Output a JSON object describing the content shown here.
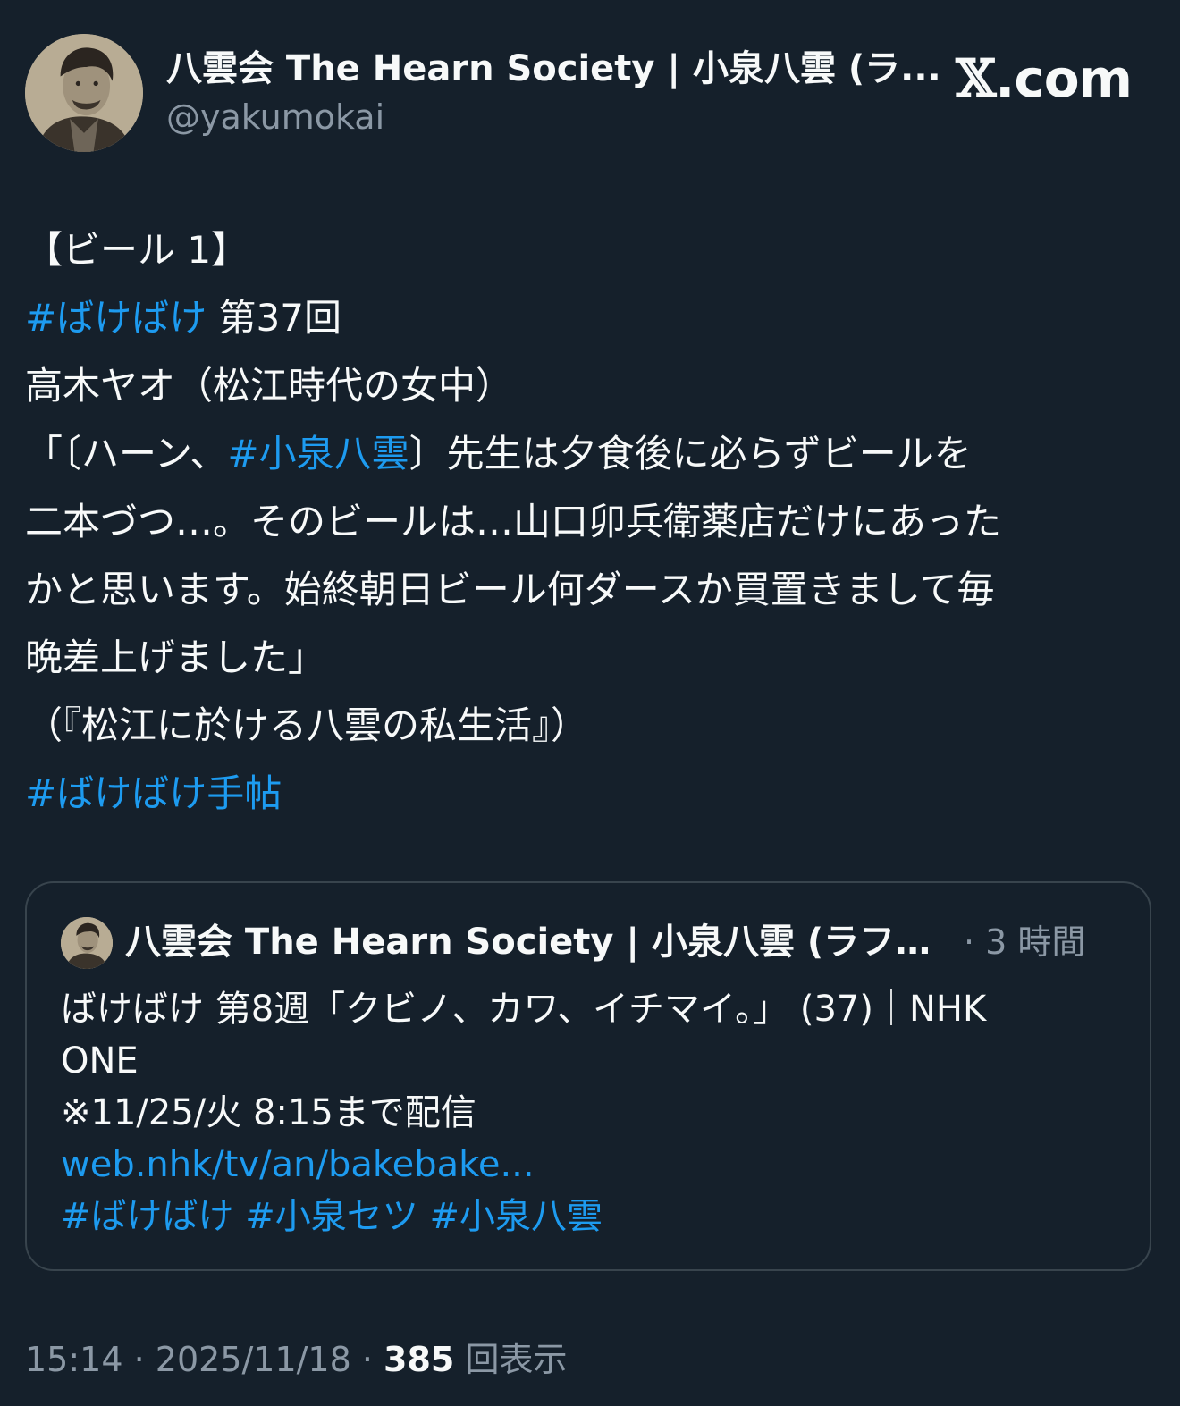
{
  "author": {
    "name": "八雲会 The Hearn Society | 小泉八雲 (ラ...",
    "handle": "@yakumokai",
    "avatar_icon": "author-portrait-avatar"
  },
  "brand": {
    "mark": "𝕏",
    "suffix": ".com"
  },
  "tweet": {
    "line1": "【ビール 1】",
    "line2_tag": "#ばけばけ",
    "line2_text": " 第37回",
    "line3": "高木ヤオ（松江時代の女中）",
    "line4_pre": "「〔ハーン、",
    "line4_tag": "#小泉八雲",
    "line4_post": "〕先生は夕食後に必らずビールを",
    "line5": "二本づつ…。そのビールは…山口卯兵衛薬店だけにあった",
    "line6": "かと思います。始終朝日ビール何ダースか買置きまして毎",
    "line7": "晩差上げました」",
    "line8": "（『松江に於ける八雲の私生活』）",
    "line9_tag": "#ばけばけ手帖"
  },
  "quote": {
    "name": "八雲会 The Hearn Society | 小泉八雲 (ラフカ...",
    "time": "· 3 時間",
    "line1": "ばけばけ 第8週「クビノ、カワ、イチマイ。」 (37)｜NHK",
    "line2": "ONE",
    "line3": "※11/25/火 8:15まで配信",
    "link": "web.nhk/tv/an/bakebake...",
    "tag1": "#ばけばけ",
    "tag2": "#小泉セツ",
    "tag3": "#小泉八雲"
  },
  "footer": {
    "time": "15:14",
    "sep1": " · ",
    "date": "2025/11/18",
    "sep2": " · ",
    "views": "385",
    "views_label": " 回表示"
  },
  "colors": {
    "background": "#15202b",
    "text": "#f7f9f9",
    "secondary": "#8b98a5",
    "link": "#1d9bf0",
    "border": "#38444d"
  }
}
